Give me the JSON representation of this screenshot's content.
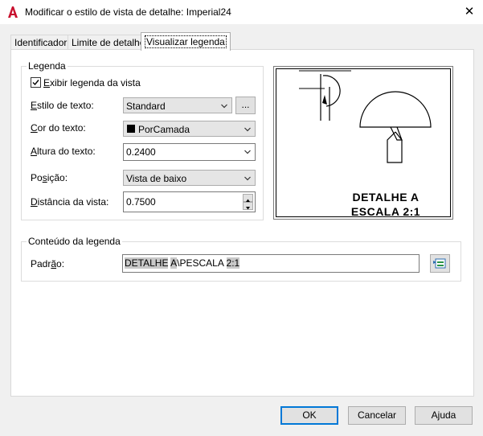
{
  "window": {
    "title": "Modificar o estilo de vista de detalhe: Imperial24",
    "close_glyph": "✕"
  },
  "tabs": [
    {
      "label": "Identificador"
    },
    {
      "label": "Limite de detalhe"
    },
    {
      "label": "Visualizar legenda",
      "active": true
    }
  ],
  "legend_group": {
    "title": "Legenda",
    "show_label_pre": "",
    "show_label_u": "E",
    "show_label_post": "xibir legenda da vista",
    "show_checked": true,
    "text_style": {
      "label_u": "E",
      "label_post": "stilo de texto:",
      "value": "Standard",
      "browse": "..."
    },
    "text_color": {
      "label_u": "C",
      "label_post": "or do texto:",
      "value": "PorCamada",
      "swatch": "#000000"
    },
    "text_height": {
      "label_u": "A",
      "label_post": "ltura do texto:",
      "value": "0.2400"
    },
    "position": {
      "label_pre": "Po",
      "label_u": "s",
      "label_post": "ição:",
      "value": "Vista de baixo"
    },
    "distance": {
      "label_u": "D",
      "label_post": "istância da vista:",
      "value": "0.7500"
    }
  },
  "preview": {
    "line1": "DETALHE A",
    "line2": "ESCALA 2:1"
  },
  "content_group": {
    "title": "Conteúdo da legenda",
    "default_label_pre": "Padr",
    "default_label_u": "ã",
    "default_label_post": "o:",
    "value_parts": [
      "DETALHE",
      " ",
      "A",
      "\\PESCALA ",
      "2:1"
    ]
  },
  "footer": {
    "ok": "OK",
    "cancel": "Cancelar",
    "help_pre": "A",
    "help_u": "j",
    "help_post": "uda"
  },
  "colors": {
    "accent": "#0078d7",
    "field_highlight": "#c8c8c8"
  }
}
